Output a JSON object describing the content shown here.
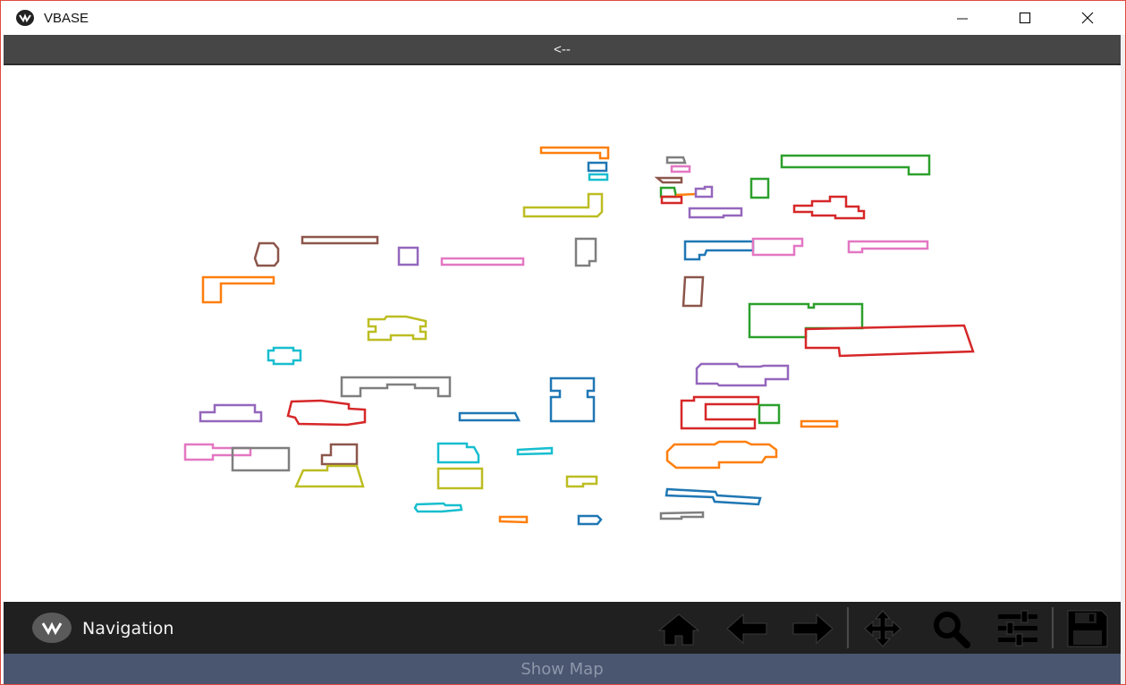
{
  "window": {
    "title": "VBASE",
    "controls": [
      "minimize-icon",
      "maximize-icon",
      "close-icon"
    ]
  },
  "backbar": {
    "label": "<--"
  },
  "map": {
    "footprint_colors": [
      "#1f77b4",
      "#ff7f0e",
      "#2ca02c",
      "#d62728",
      "#9467bd",
      "#8c564b",
      "#e377c2",
      "#7f7f7f",
      "#bcbd22",
      "#17becf"
    ],
    "footprint_count": 60
  },
  "navigation_toolbar": {
    "label": "Navigation",
    "tools": [
      {
        "name": "home-icon",
        "tooltip_free": true
      },
      {
        "name": "back-arrow-icon"
      },
      {
        "name": "forward-arrow-icon"
      },
      {
        "name": "pan-move-icon"
      },
      {
        "name": "zoom-magnifier-icon"
      },
      {
        "name": "configure-subplots-icon"
      },
      {
        "name": "save-floppy-icon"
      }
    ]
  },
  "show_map_button": {
    "label": "Show Map"
  }
}
